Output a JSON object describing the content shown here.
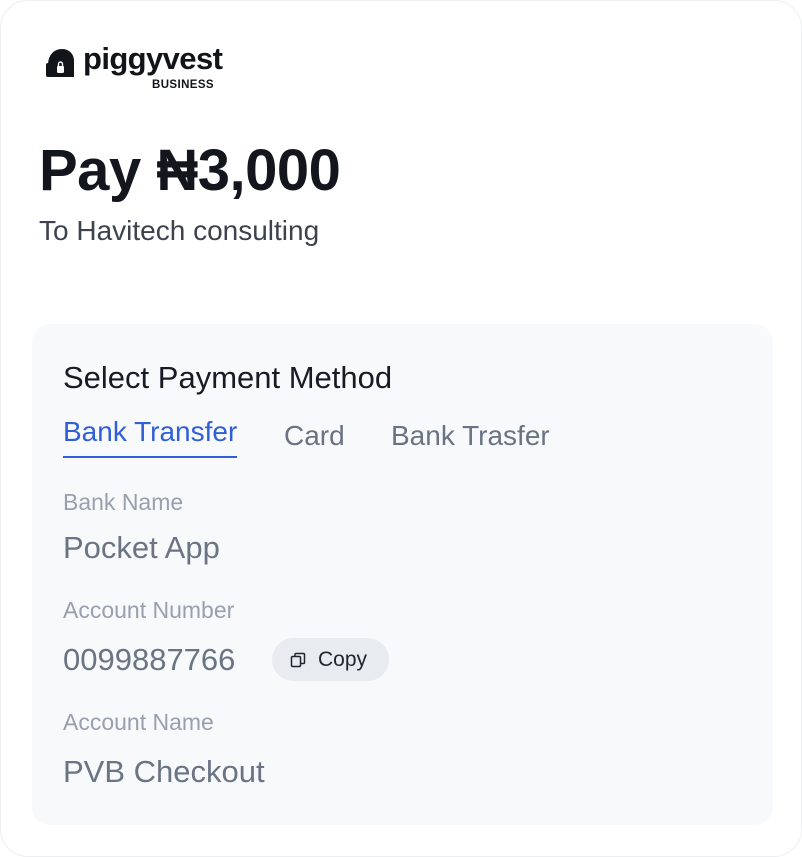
{
  "brand": {
    "name": "piggyvest",
    "sub": "BUSINESS"
  },
  "payment": {
    "title": "Pay ₦3,000",
    "recipient": "To Havitech consulting"
  },
  "method": {
    "heading": "Select Payment Method",
    "tabs": [
      {
        "label": "Bank Transfer",
        "active": true
      },
      {
        "label": "Card",
        "active": false
      },
      {
        "label": "Bank Trasfer",
        "active": false
      }
    ]
  },
  "details": {
    "bank_name_label": "Bank Name",
    "bank_name_value": "Pocket App",
    "account_number_label": "Account Number",
    "account_number_value": "0099887766",
    "copy_label": "Copy",
    "account_name_label": "Account Name",
    "account_name_value": "PVB Checkout"
  },
  "colors": {
    "accent": "#2f5ed6",
    "title": "#13161d",
    "panel_bg": "#f8f9fb"
  },
  "icons": {
    "logo": "piggy-lock-icon",
    "copy": "copy-icon"
  }
}
